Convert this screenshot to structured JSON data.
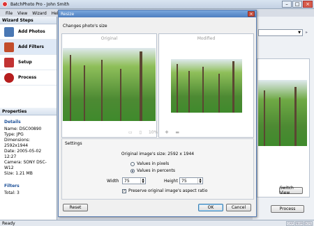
{
  "app": {
    "title": "BatchPhoto Pro - John Smith",
    "status": "Ready",
    "status_cells": [
      "CAP",
      "NUM",
      "SCRL"
    ]
  },
  "menu": [
    "File",
    "View",
    "Wizard",
    "Help"
  ],
  "wizard": {
    "heading": "Wizard Steps",
    "steps": [
      {
        "label": "Add Photos",
        "color": "#4a78b4"
      },
      {
        "label": "Add Filters",
        "color": "#c24d2b"
      },
      {
        "label": "Setup",
        "color": "#c23333"
      },
      {
        "label": "Process",
        "color": "#b61e1e"
      }
    ]
  },
  "properties": {
    "heading": "Properties",
    "details_title": "Details",
    "details": [
      "Name: DSC00890",
      "Type: JPG",
      "Dimensions: 2592x1944",
      "Date: 2005-05-02 12:27",
      "Camera: SONY DSC-W12",
      "Size: 1.21 MB"
    ],
    "filters_title": "Filters",
    "filters_total": "Total: 3"
  },
  "right": {
    "switch_view": "Switch View",
    "process": "Process"
  },
  "dialog": {
    "title": "Resize",
    "subtitle": "Changes photo's size",
    "original_label": "Original",
    "modified_label": "Modified",
    "zoom": "10%",
    "settings_label": "Settings",
    "original_size": "Original image's size: 2592 x 1944",
    "option_pixels": "Values in pixels",
    "option_percent": "Values in percents",
    "width_label": "Width",
    "width_value": "75",
    "height_label": "Height",
    "height_value": "75",
    "preserve": "Preserve original image's aspect ratio",
    "reset": "Reset",
    "ok": "OK",
    "cancel": "Cancel"
  },
  "colors": {
    "accent": "#4e7fc0",
    "forest_sky": "#dfe9ee",
    "forest_grass": "#3f8a2c",
    "forest_foliage": "#6fa945"
  }
}
